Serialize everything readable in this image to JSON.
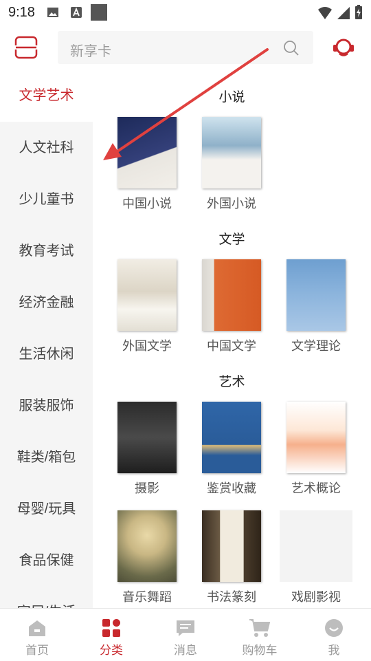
{
  "status_bar": {
    "time": "9:18"
  },
  "header": {
    "search_placeholder": "新享卡"
  },
  "sidebar": {
    "items": [
      {
        "label": "文学艺术",
        "active": true
      },
      {
        "label": "人文社科"
      },
      {
        "label": "少儿童书"
      },
      {
        "label": "教育考试"
      },
      {
        "label": "经济金融"
      },
      {
        "label": "生活休闲"
      },
      {
        "label": "服装服饰"
      },
      {
        "label": "鞋类/箱包"
      },
      {
        "label": "母婴/玩具"
      },
      {
        "label": "食品保健"
      },
      {
        "label": "家居/生活"
      }
    ]
  },
  "sections": [
    {
      "title": "小说",
      "books": [
        {
          "label": "中国小说"
        },
        {
          "label": "外国小说"
        }
      ]
    },
    {
      "title": "文学",
      "books": [
        {
          "label": "外国文学"
        },
        {
          "label": "中国文学"
        },
        {
          "label": "文学理论"
        }
      ]
    },
    {
      "title": "艺术",
      "books": [
        {
          "label": "摄影"
        },
        {
          "label": "鉴赏收藏"
        },
        {
          "label": "艺术概论"
        },
        {
          "label": "音乐舞蹈"
        },
        {
          "label": "书法篆刻"
        },
        {
          "label": "戏剧影视"
        }
      ]
    }
  ],
  "bottom_nav": [
    {
      "label": "首页",
      "icon": "home-icon"
    },
    {
      "label": "分类",
      "icon": "category-icon",
      "active": true
    },
    {
      "label": "消息",
      "icon": "message-icon"
    },
    {
      "label": "购物车",
      "icon": "cart-icon"
    },
    {
      "label": "我",
      "icon": "profile-icon"
    }
  ],
  "colors": {
    "accent": "#c8282d",
    "annotation_arrow": "#e0413f"
  }
}
